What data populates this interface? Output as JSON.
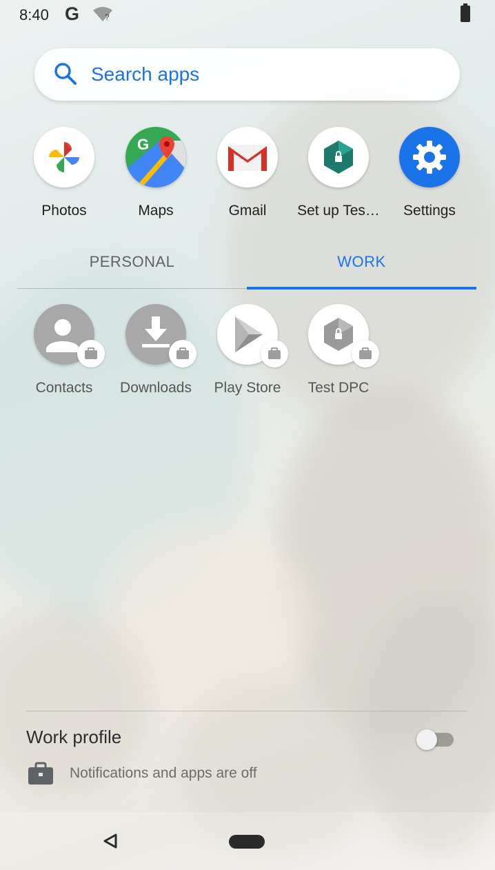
{
  "status_bar": {
    "time": "8:40",
    "google_glyph": "G",
    "wifi_glyph": "?"
  },
  "search": {
    "placeholder": "Search apps"
  },
  "top_apps": [
    {
      "label": "Photos",
      "icon": "photos-icon"
    },
    {
      "label": "Maps",
      "icon": "maps-icon"
    },
    {
      "label": "Gmail",
      "icon": "gmail-icon"
    },
    {
      "label": "Set up Tes…",
      "icon": "setup-test-dpc-icon"
    },
    {
      "label": "Settings",
      "icon": "settings-icon"
    }
  ],
  "tabs": {
    "personal": "PERSONAL",
    "work": "WORK",
    "active": "WORK"
  },
  "work_apps": [
    {
      "label": "Contacts",
      "icon": "contacts-icon"
    },
    {
      "label": "Downloads",
      "icon": "downloads-icon"
    },
    {
      "label": "Play Store",
      "icon": "play-store-icon"
    },
    {
      "label": "Test DPC",
      "icon": "test-dpc-icon"
    }
  ],
  "work_profile": {
    "title": "Work profile",
    "status": "Notifications and apps are off",
    "toggle_on": false
  },
  "colors": {
    "accent": "#1a73e8",
    "settings_blue": "#1a73e8",
    "test_dpc_teal": "#1e7a6e"
  }
}
